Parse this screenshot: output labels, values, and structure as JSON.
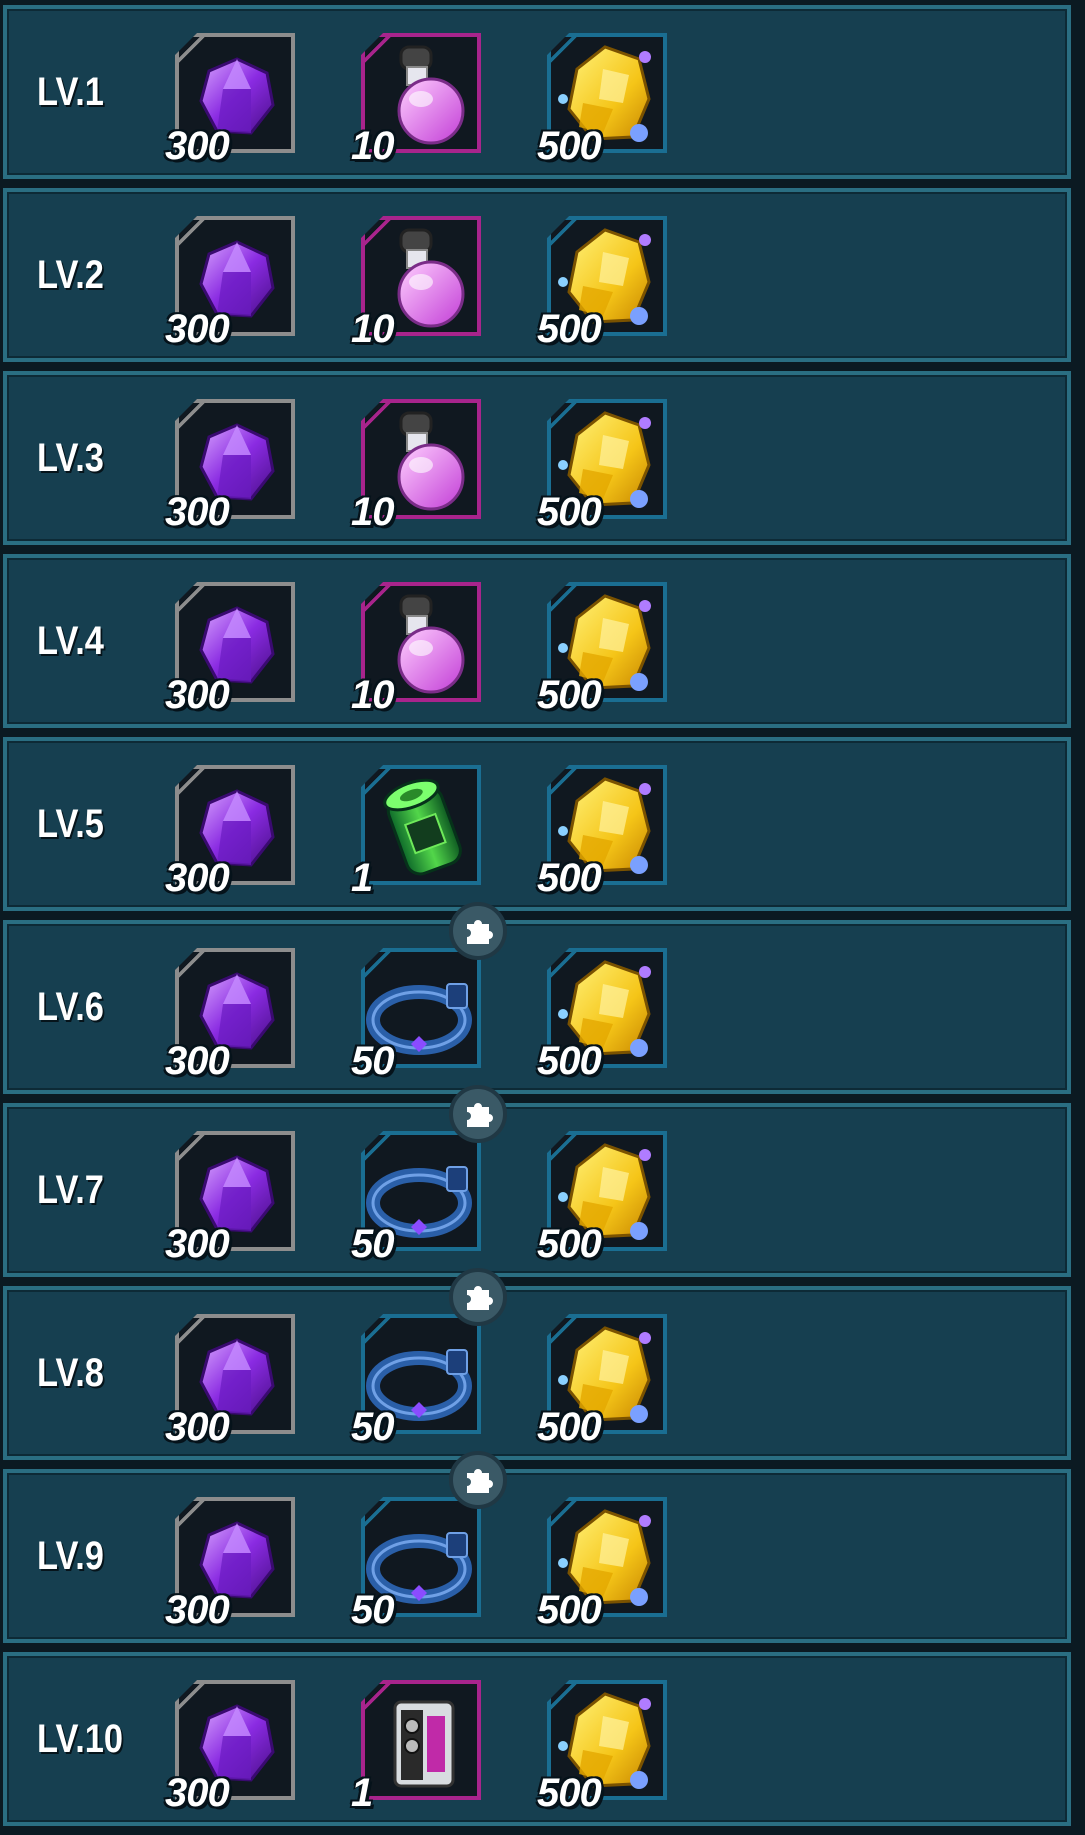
{
  "rows": [
    {
      "level": "LV.1",
      "gem_qty": "300",
      "mid_item": "potion",
      "mid_qty": "10",
      "gold_qty": "500"
    },
    {
      "level": "LV.2",
      "gem_qty": "300",
      "mid_item": "potion",
      "mid_qty": "10",
      "gold_qty": "500"
    },
    {
      "level": "LV.3",
      "gem_qty": "300",
      "mid_item": "potion",
      "mid_qty": "10",
      "gold_qty": "500"
    },
    {
      "level": "LV.4",
      "gem_qty": "300",
      "mid_item": "potion",
      "mid_qty": "10",
      "gold_qty": "500"
    },
    {
      "level": "LV.5",
      "gem_qty": "300",
      "mid_item": "green-canister",
      "mid_qty": "1",
      "gold_qty": "500"
    },
    {
      "level": "LV.6",
      "gem_qty": "300",
      "mid_item": "collar-fragment",
      "mid_qty": "50",
      "gold_qty": "500"
    },
    {
      "level": "LV.7",
      "gem_qty": "300",
      "mid_item": "collar-fragment",
      "mid_qty": "50",
      "gold_qty": "500"
    },
    {
      "level": "LV.8",
      "gem_qty": "300",
      "mid_item": "collar-fragment",
      "mid_qty": "50",
      "gold_qty": "500"
    },
    {
      "level": "LV.9",
      "gem_qty": "300",
      "mid_item": "collar-fragment",
      "mid_qty": "50",
      "gold_qty": "500"
    },
    {
      "level": "LV.10",
      "gem_qty": "300",
      "mid_item": "device",
      "mid_qty": "1",
      "gold_qty": "500"
    }
  ],
  "colors": {
    "row_bg": "#163f50",
    "row_border": "#2a6e82",
    "frame_grey": "#8d8d8d",
    "frame_purple": "#a8248c",
    "frame_blue": "#1a6e92",
    "gem": "#8a2be2",
    "gold": "#f5c518"
  },
  "icons": {
    "gem": "purple-gem-icon",
    "potion": "potion-flask-icon",
    "green-canister": "green-canister-icon",
    "collar-fragment": "collar-icon",
    "device": "device-icon",
    "gold": "gold-ore-icon",
    "fragment_badge": "puzzle-piece-icon"
  }
}
